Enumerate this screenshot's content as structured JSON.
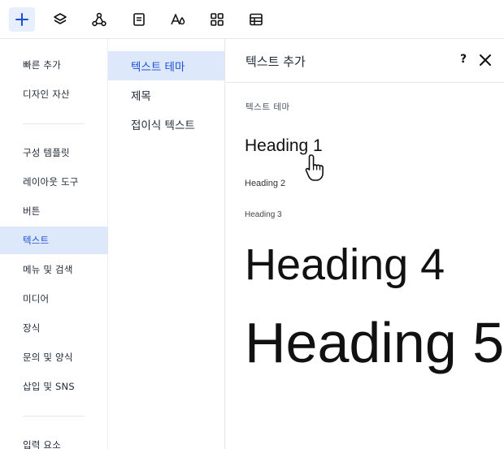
{
  "toolbar": {
    "buttons": [
      {
        "name": "add-icon",
        "active": true
      },
      {
        "name": "layers-icon",
        "active": false
      },
      {
        "name": "graph-icon",
        "active": false
      },
      {
        "name": "page-icon",
        "active": false
      },
      {
        "name": "theme-icon",
        "active": false
      },
      {
        "name": "apps-grid-icon",
        "active": false
      },
      {
        "name": "table-icon",
        "active": false
      }
    ]
  },
  "sidebar": {
    "items": [
      {
        "label": "빠른 추가"
      },
      {
        "label": "디자인 자산"
      },
      {
        "label": "구성 템플릿"
      },
      {
        "label": "레이아웃 도구"
      },
      {
        "label": "버튼"
      },
      {
        "label": "텍스트"
      },
      {
        "label": "메뉴 및 검색"
      },
      {
        "label": "미디어"
      },
      {
        "label": "장식"
      },
      {
        "label": "문의 및 양식"
      },
      {
        "label": "삽입 및 SNS"
      },
      {
        "label": "입력 요소"
      }
    ],
    "active_index": 5
  },
  "midcol": {
    "items": [
      {
        "label": "텍스트 테마"
      },
      {
        "label": "제목"
      },
      {
        "label": "접이식 텍스트"
      }
    ],
    "active_index": 0
  },
  "panel": {
    "title": "텍스트 추가",
    "help": "?",
    "section_label": "텍스트 테마",
    "headings": [
      "Heading 1",
      "Heading 2",
      "Heading 3",
      "Heading 4",
      "Heading 5"
    ]
  },
  "colors": {
    "accent": "#1a4fd6",
    "active_bg": "#dde8fb",
    "toolbar_active_bg": "#e7efff"
  }
}
